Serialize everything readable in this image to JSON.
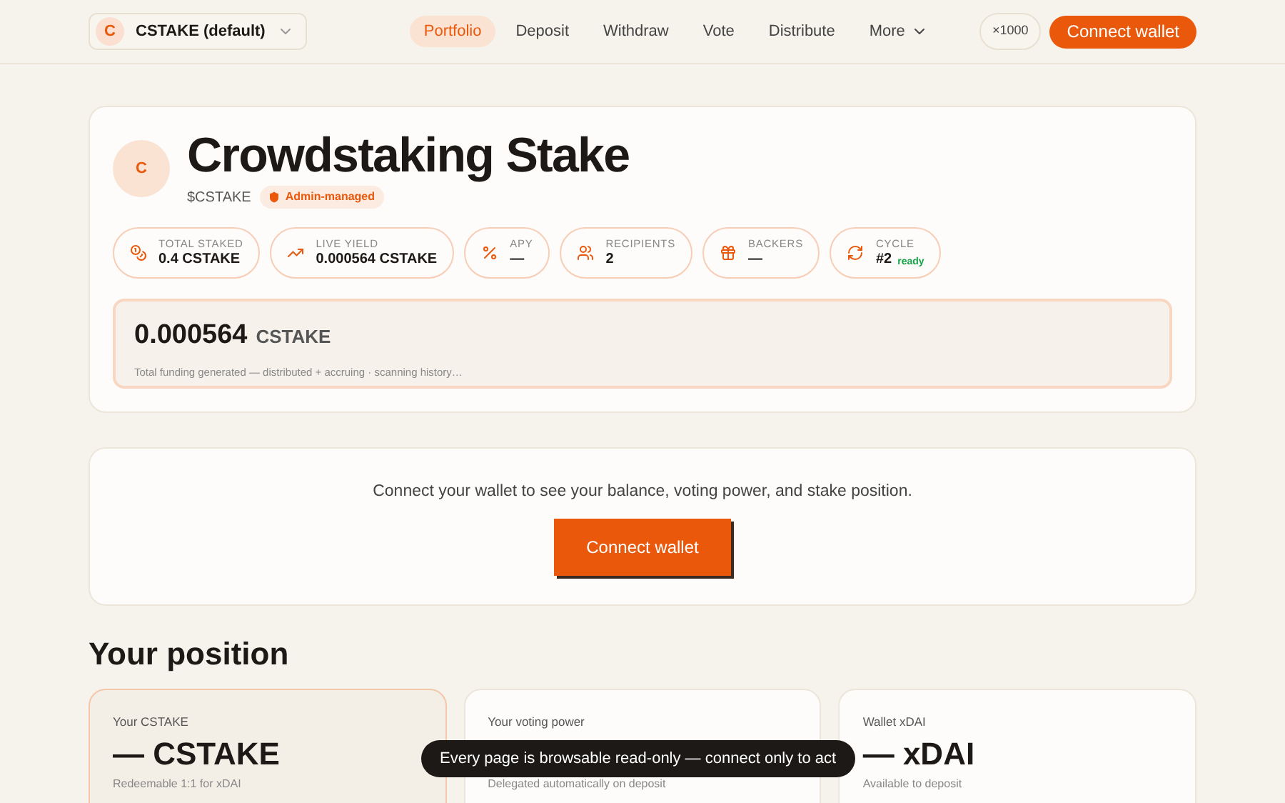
{
  "token_selector": {
    "initial": "C",
    "label": "CSTAKE (default)"
  },
  "nav": [
    {
      "label": "Portfolio",
      "selected": true
    },
    {
      "label": "Deposit",
      "selected": false
    },
    {
      "label": "Withdraw",
      "selected": false
    },
    {
      "label": "Vote",
      "selected": false
    },
    {
      "label": "Distribute",
      "selected": false
    },
    {
      "label": "More",
      "selected": false,
      "kind": "menu"
    }
  ],
  "speed_badge": "×1000",
  "connect_button": "Connect wallet",
  "hero": {
    "initial": "C",
    "title": "Crowdstaking Stake",
    "symbol": "$CSTAKE",
    "badge": "Admin-managed",
    "stats": [
      {
        "kind": "coins",
        "label": "TOTAL STAKED",
        "value": "0.4 CSTAKE"
      },
      {
        "kind": "trend",
        "label": "LIVE YIELD",
        "value": "0.000564 CSTAKE"
      },
      {
        "kind": "percent",
        "label": "APY",
        "value": "—"
      },
      {
        "kind": "people",
        "label": "RECIPIENTS",
        "value": "2"
      },
      {
        "kind": "gift",
        "label": "BACKERS",
        "value": "—"
      },
      {
        "kind": "cycle",
        "label": "CYCLE",
        "value": "#2",
        "status": "ready"
      }
    ],
    "funding": {
      "amount": "0.000564",
      "unit": "CSTAKE",
      "note": "Total funding generated — distributed + accruing · scanning history…"
    }
  },
  "connect_card": {
    "message": "Connect your wallet to see your balance, voting power, and stake position.",
    "button": "Connect wallet"
  },
  "position": {
    "title": "Your position",
    "cards": [
      {
        "label": "Your CSTAKE",
        "value": "— CSTAKE",
        "note": "Redeemable 1:1 for xDAI",
        "selected": true
      },
      {
        "label": "Your voting power",
        "note": "Delegated automatically on deposit",
        "selected": false
      },
      {
        "label": "Wallet xDAI",
        "value": "— xDAI",
        "note": "Available to deposit",
        "selected": false
      }
    ]
  },
  "toast": "Every page is browsable read-only — connect only to act"
}
